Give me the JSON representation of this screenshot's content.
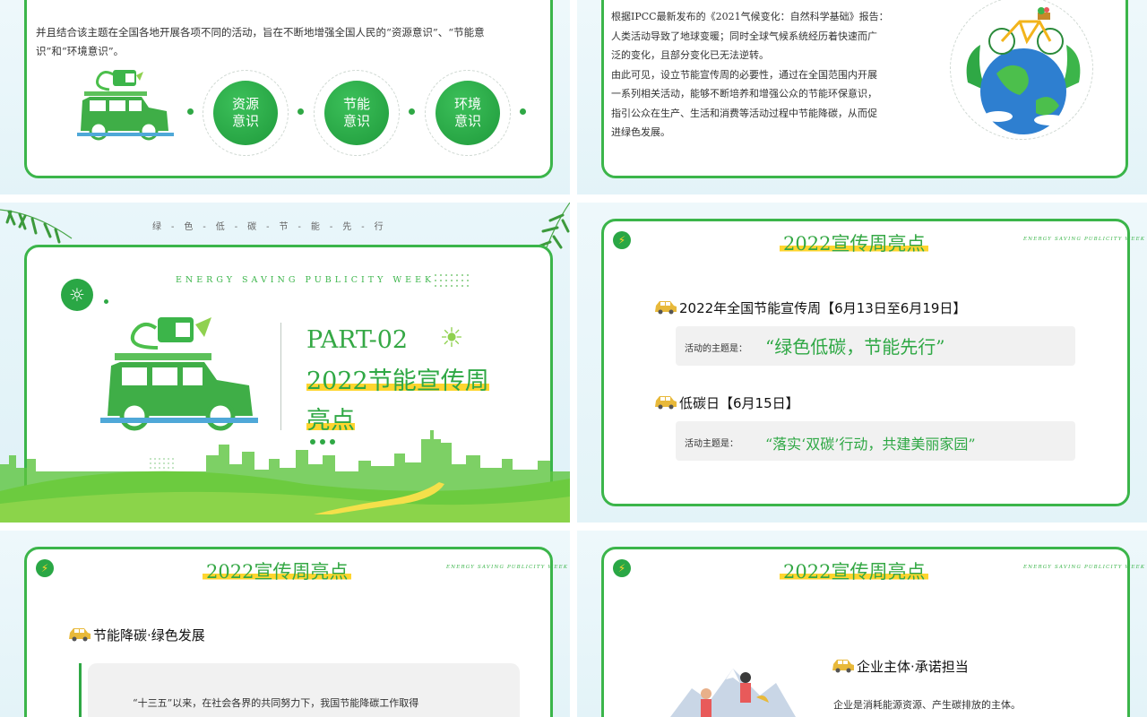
{
  "slide1": {
    "paragraph": "并且结合该主题在全国各地开展各项不同的活动，旨在不断地增强全国人民的“资源意识”、“节能意识”和“环境意识”。",
    "circles": [
      "资源意识",
      "节能意识",
      "环境意识"
    ]
  },
  "slide2": {
    "lines": [
      "根据IPCC最新发布的《2021气候变化：自然科学基础》报告：",
      "人类活动导致了地球变暖；同时全球气候系统经历着快速而广",
      "泛的变化，且部分变化已无法逆转。",
      "由此可见，设立节能宣传周的必要性，通过在全国范围内开展",
      "一系列相关活动，能够不断培养和增强公众的节能环保意识，",
      "指引公众在生产、生活和消费等活动过程中节能降碳，从而促",
      "进绿色发展。"
    ]
  },
  "slide3": {
    "tagline": "绿-色-低-碳-节-能-先-行",
    "english": "ENERGY SAVING PUBLICITY WEEK",
    "part": "PART-02",
    "title_line1": "2022节能宣传周",
    "title_line2": "亮点"
  },
  "slide4": {
    "heading": "2022宣传周亮点",
    "english": "ENERGY SAVING PUBLICITY WEEK",
    "item1_title": "2022年全国节能宣传周【6月13日至6月19日】",
    "item1_label": "活动的主题是：",
    "item1_quote": "“绿色低碳，节能先行”",
    "item2_title": "低碳日【6月15日】",
    "item2_label": "活动主题是：",
    "item2_quote": "“落实‘双碳’行动，共建美丽家园”"
  },
  "slide5": {
    "heading": "2022宣传周亮点",
    "english": "ENERGY SAVING PUBLICITY WEEK",
    "item_title": "节能降碳·绿色发展",
    "text": "“十三五”以来，在社会各界的共同努力下，我国节能降碳工作取得"
  },
  "slide6": {
    "heading": "2022宣传周亮点",
    "english": "ENERGY SAVING PUBLICITY WEEK",
    "item_title": "企业主体·承诺担当",
    "text": "企业是消耗能源资源、产生碳排放的主体。"
  },
  "colors": {
    "green": "#2fa845",
    "yellow": "#ffd52e",
    "border": "#3bb54a"
  }
}
